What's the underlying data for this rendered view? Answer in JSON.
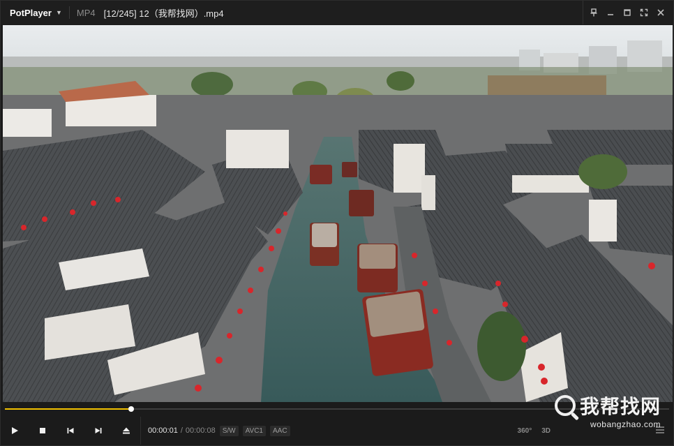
{
  "app": {
    "name": "PotPlayer",
    "format": "MP4",
    "file_title": "[12/245] 12（我帮找网）.mp4"
  },
  "window_controls": [
    "pin-icon",
    "minimize-icon",
    "maximize-icon",
    "fullscreen-icon",
    "close-icon"
  ],
  "playback": {
    "current_time": "00:00:01",
    "total_time": "00:00:08",
    "progress": 0.19,
    "tags": [
      "S/W",
      "AVC1",
      "AAC"
    ]
  },
  "controls": {
    "buttons": [
      "play-icon",
      "stop-icon",
      "previous-icon",
      "next-icon",
      "eject-icon"
    ],
    "right": [
      "360°",
      "3D"
    ]
  },
  "watermark": {
    "text": "我帮找网",
    "url": "wobangzhao.com"
  },
  "colors": {
    "accent": "#f2c200",
    "background": "#1b1b1b"
  }
}
